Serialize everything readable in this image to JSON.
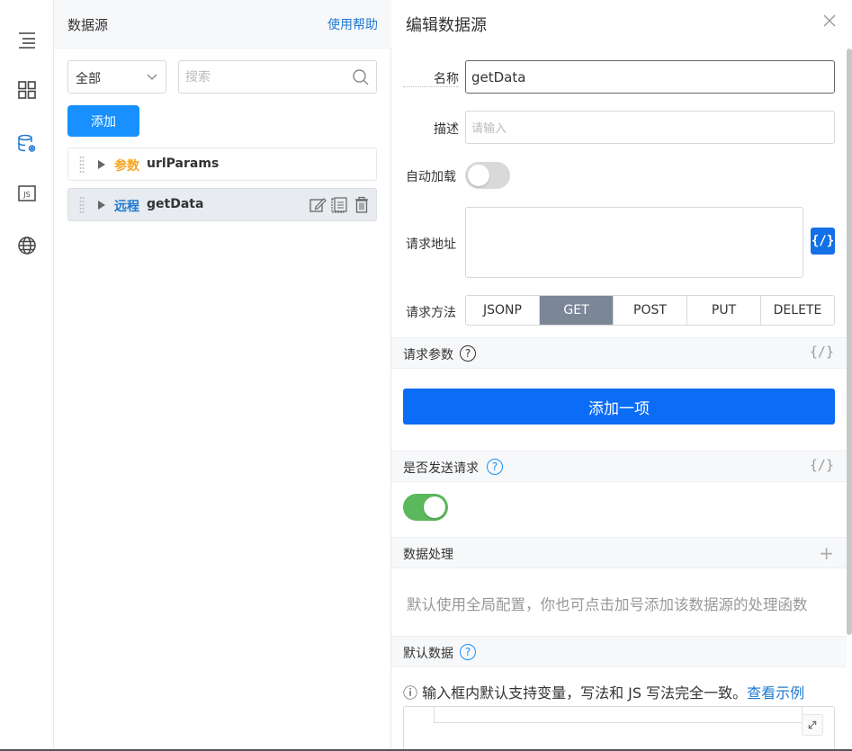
{
  "rail": {
    "icons": [
      "outline-icon",
      "components-icon",
      "datasource-icon",
      "js-icon",
      "globe-icon"
    ],
    "active": "datasource-icon",
    "js_label": "JS"
  },
  "ds_panel": {
    "title": "数据源",
    "help_link": "使用帮助",
    "filter_value": "全部",
    "search_placeholder": "搜索",
    "add_label": "添加",
    "items": [
      {
        "type": "参数",
        "type_color": "#f5a623",
        "name": "urlParams",
        "active": false
      },
      {
        "type": "远程",
        "type_color": "#1f78d1",
        "name": "getData",
        "active": true
      }
    ]
  },
  "editor": {
    "title": "编辑数据源",
    "name_label": "名称",
    "name_value": "getData",
    "desc_label": "描述",
    "desc_placeholder": "请输入",
    "autoload_label": "自动加载",
    "autoload_on": false,
    "url_label": "请求地址",
    "url_value": "",
    "fx_label": "{/}",
    "method_label": "请求方法",
    "methods": [
      "JSONP",
      "GET",
      "POST",
      "PUT",
      "DELETE"
    ],
    "method_selected": "GET",
    "params_section": "请求参数",
    "params_fx": "{/}",
    "add_item_label": "添加一项",
    "send_section": "是否发送请求",
    "send_fx": "{/}",
    "send_on": true,
    "process_section": "数据处理",
    "process_plus": "+",
    "process_hint": "默认使用全局配置，你也可点击加号添加该数据源的处理函数",
    "default_section": "默认数据",
    "default_note": "ⓘ 输入框内默认支持变量，写法和 JS 写法完全一致。",
    "default_note_link": "查看示例",
    "qmark": "?",
    "colors": {
      "primary": "#1890ff",
      "button_blue": "#0b6cf5",
      "toggle_on": "#5cb85c",
      "method_active": "#7b8797"
    }
  }
}
